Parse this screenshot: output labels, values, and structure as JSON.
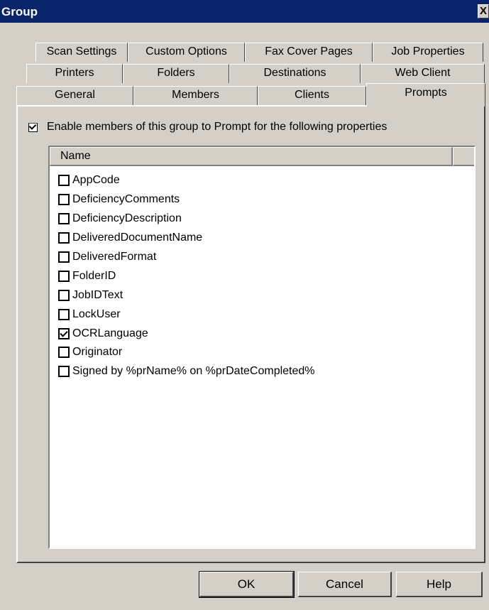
{
  "window": {
    "title": "Group",
    "close_glyph": "X"
  },
  "tabs": {
    "row1": [
      "Scan Settings",
      "Custom Options",
      "Fax Cover Pages",
      "Job Properties"
    ],
    "row2": [
      "Printers",
      "Folders",
      "Destinations",
      "Web Client"
    ],
    "row3": [
      "General",
      "Members",
      "Clients",
      "Prompts"
    ],
    "active": "Prompts"
  },
  "enable": {
    "label": "Enable members of this group to Prompt for the following properties",
    "checked": true
  },
  "list": {
    "column_header": "Name",
    "items": [
      {
        "label": "AppCode",
        "checked": false
      },
      {
        "label": "DeficiencyComments",
        "checked": false
      },
      {
        "label": "DeficiencyDescription",
        "checked": false
      },
      {
        "label": "DeliveredDocumentName",
        "checked": false
      },
      {
        "label": "DeliveredFormat",
        "checked": false
      },
      {
        "label": "FolderID",
        "checked": false
      },
      {
        "label": "JobIDText",
        "checked": false
      },
      {
        "label": "LockUser",
        "checked": false
      },
      {
        "label": "OCRLanguage",
        "checked": true
      },
      {
        "label": "Originator",
        "checked": false
      },
      {
        "label": "Signed by %prName% on %prDateCompleted%",
        "checked": false
      }
    ]
  },
  "buttons": {
    "ok": "OK",
    "cancel": "Cancel",
    "help": "Help"
  }
}
